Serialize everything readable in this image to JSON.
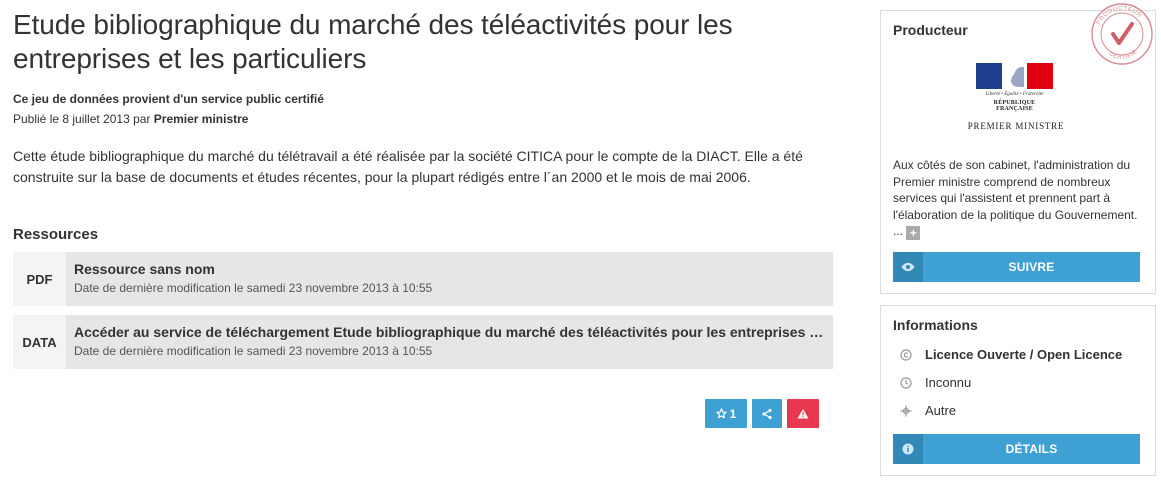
{
  "dataset": {
    "title": "Etude bibliographique du marché des téléactivités pour les entreprises et les particuliers",
    "certified_text": "Ce jeu de données provient d'un service public certifié",
    "published_prefix": "Publié le 8 juillet 2013 par ",
    "publisher": "Premier ministre",
    "description": "Cette étude bibliographique du marché du télétravail a été réalisée par la société CITICA pour le compte de la DIACT. Elle a été construite sur la base de documents et études récentes, pour la plupart rédigés entre l´an 2000 et le mois de mai 2006."
  },
  "resources": {
    "heading": "Ressources",
    "items": [
      {
        "format": "PDF",
        "title": "Ressource sans nom",
        "date": "Date de dernière modification le samedi 23 novembre 2013 à 10:55"
      },
      {
        "format": "DATA",
        "title": "Accéder au service de téléchargement Etude bibliographique du marché des téléactivités pour les entreprises et les particuliers",
        "date": "Date de dernière modification le samedi 23 novembre 2013 à 10:55"
      }
    ]
  },
  "actions": {
    "follow_count": "1",
    "follow_icon": "star-outline-icon",
    "share_icon": "share-icon",
    "alert_icon": "warning-icon"
  },
  "producer": {
    "heading": "Producteur",
    "logo_motto": "Liberté • Égalité • Fraternité",
    "logo_republic": "RÉPUBLIQUE FRANÇAISE",
    "logo_name": "PREMIER MINISTRE",
    "stamp_top": "PRODUCTEUR",
    "stamp_bottom": "CERTIFIÉ",
    "description": "Aux côtés de son cabinet, l'administration du Premier ministre comprend de nombreux services qui l'assistent et prennent part à l'élaboration de la politique du Gouvernement. ...",
    "more_label": "+",
    "follow_label": "SUIVRE"
  },
  "informations": {
    "heading": "Informations",
    "license": "Licence Ouverte / Open Licence",
    "frequency": "Inconnu",
    "zone": "Autre",
    "details_label": "DÉTAILS"
  },
  "colors": {
    "primary": "#3fa0d3",
    "primary_dark": "#3288b6",
    "danger": "#e8384f",
    "flag_blue": "#1f3f8f",
    "flag_red": "#e1000f"
  }
}
